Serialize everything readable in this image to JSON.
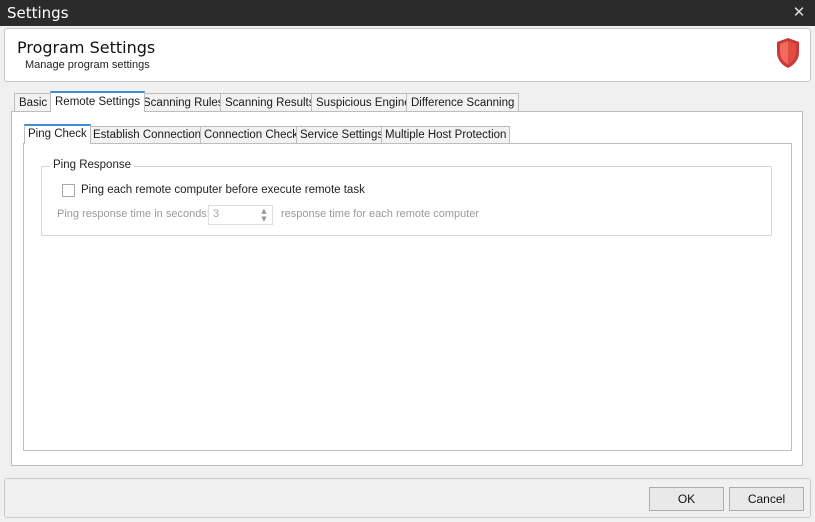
{
  "window": {
    "title": "Settings",
    "close_glyph": "✕"
  },
  "header": {
    "title": "Program Settings",
    "subtitle": "Manage program settings",
    "icon": "shield-icon",
    "accent": "#d9534f"
  },
  "tabs": [
    {
      "label": "Basic",
      "active": false
    },
    {
      "label": "Remote Settings",
      "active": true
    },
    {
      "label": "Scanning Rules",
      "active": false
    },
    {
      "label": "Scanning Results",
      "active": false
    },
    {
      "label": "Suspicious Engine",
      "active": false
    },
    {
      "label": "Difference Scanning",
      "active": false
    }
  ],
  "subtabs": [
    {
      "label": "Ping Check",
      "active": true
    },
    {
      "label": "Establish Connections",
      "active": false
    },
    {
      "label": "Connection Check",
      "active": false
    },
    {
      "label": "Service Settings",
      "active": false
    },
    {
      "label": "Multiple Host Protection",
      "active": false
    }
  ],
  "ping_response": {
    "group_label": "Ping Response",
    "checkbox_label": "Ping each remote computer before execute remote task",
    "checked": false,
    "time_label": "Ping response time in seconds:",
    "time_value": "3",
    "time_suffix": "response time for each remote computer"
  },
  "footer": {
    "ok_label": "OK",
    "cancel_label": "Cancel"
  }
}
